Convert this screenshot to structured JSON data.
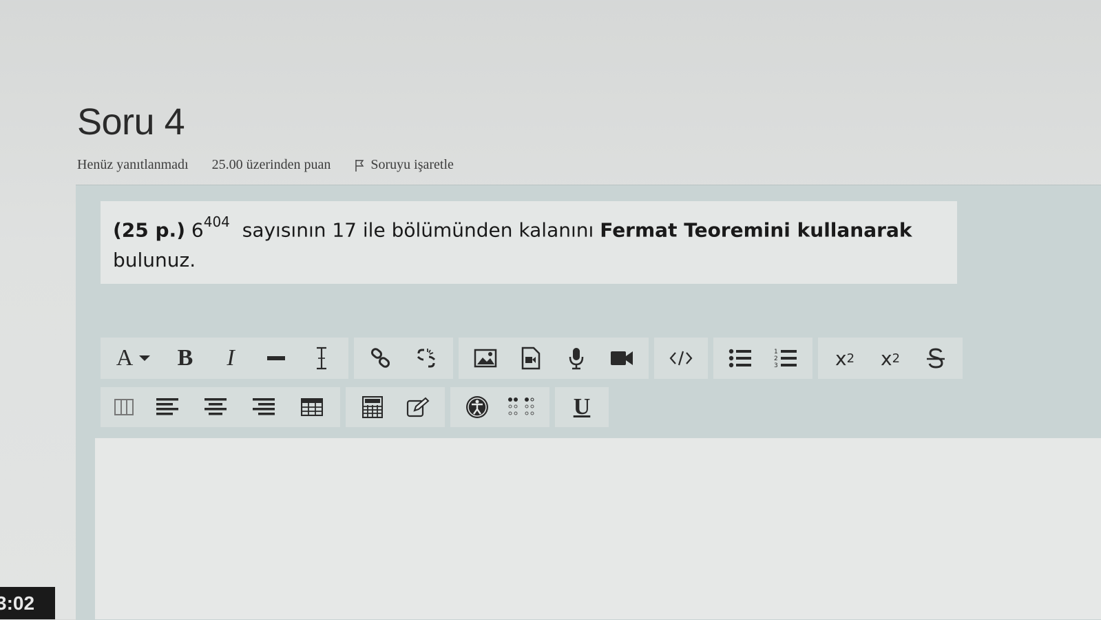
{
  "question": {
    "title": "Soru 4",
    "status": "Henüz yanıtlanmadı",
    "points": "25.00 üzerinden puan",
    "flag_label": "Soruyu işaretle",
    "text": {
      "prefix_bold": "(25 p.)",
      "base": "6",
      "exponent": "404",
      "middle": "sayısının 17 ile bölümünden kalanını",
      "emphasis_bold": "Fermat Teoremini kullanarak",
      "suffix": "bulunuz."
    }
  },
  "toolbar": {
    "font_button": "A",
    "bold_label": "B",
    "italic_label": "I",
    "underline_label": "U",
    "subscript_base": "x",
    "subscript_sub": "2",
    "superscript_base": "x",
    "superscript_sup": "2"
  },
  "editor": {
    "value": ""
  },
  "overlay": {
    "timer": "3:02"
  }
}
